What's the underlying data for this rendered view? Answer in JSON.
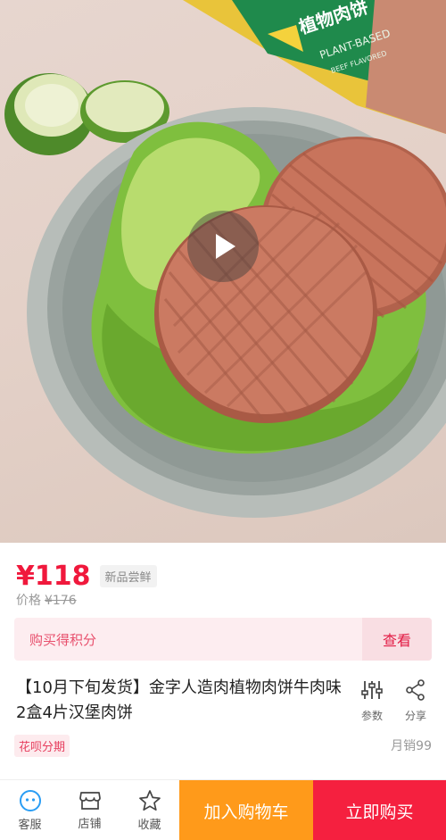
{
  "hero": {
    "package_text_main": "植物肉饼",
    "package_text_sub": "PLANT-BASED",
    "package_text_sub2": "BEEF FLAVORED"
  },
  "price": {
    "current": "¥118",
    "badge": "新品尝鲜",
    "original_label": "价格",
    "original_value": "¥176"
  },
  "points": {
    "text": "购买得积分",
    "action": "查看"
  },
  "product": {
    "title": "【10月下旬发货】金字人造肉植物肉饼牛肉味2盒4片汉堡肉饼",
    "installment_tag": "花呗分期",
    "monthly_sales": "月销99"
  },
  "actions": {
    "params_label": "参数",
    "share_label": "分享"
  },
  "bottom_bar": {
    "service_label": "客服",
    "store_label": "店铺",
    "favorite_label": "收藏",
    "add_to_cart": "加入购物车",
    "buy_now": "立即购买"
  },
  "colors": {
    "price_red": "#f0183c",
    "cart_orange": "#ff9a1a",
    "buy_red": "#f5203f"
  }
}
